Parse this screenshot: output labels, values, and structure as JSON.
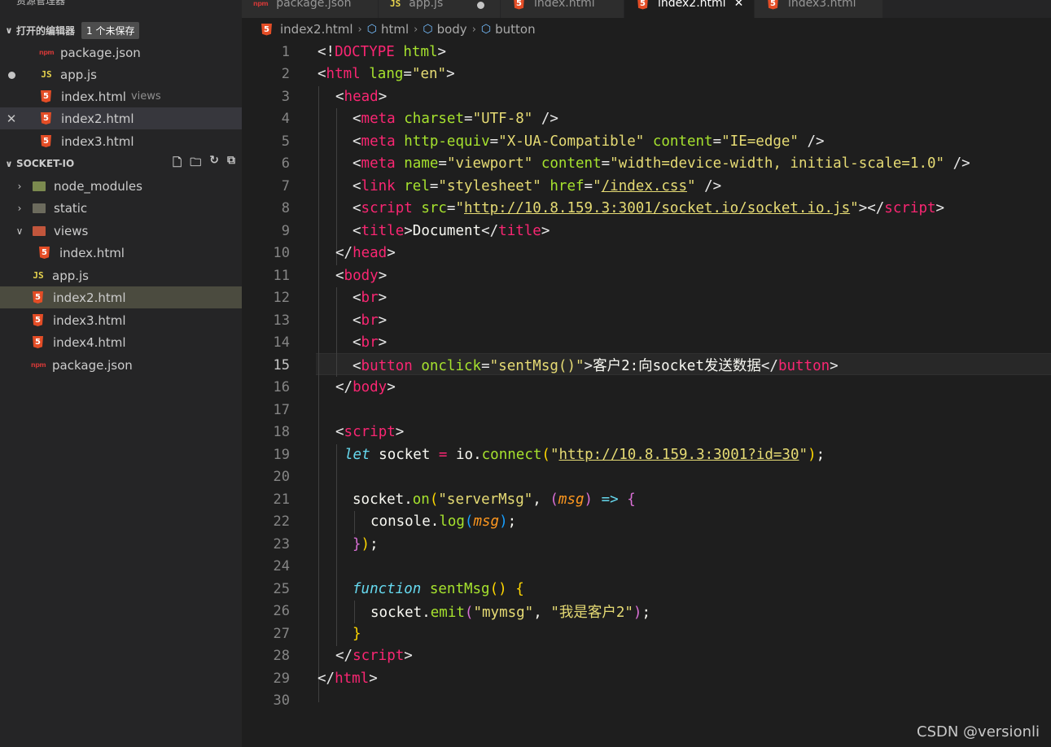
{
  "sidebar": {
    "title": "资源管理器",
    "more": "···",
    "open_editors": {
      "header": "打开的编辑器",
      "badge": "1 个未保存",
      "items": [
        {
          "name": "package.json",
          "icon": "npm-icon",
          "status": ""
        },
        {
          "name": "app.js",
          "icon": "js-icon",
          "status": "modified"
        },
        {
          "name": "index.html",
          "icon": "html5-icon",
          "hint": "views",
          "status": ""
        },
        {
          "name": "index2.html",
          "icon": "html5-icon",
          "status": "close"
        },
        {
          "name": "index3.html",
          "icon": "html5-icon",
          "status": ""
        }
      ]
    },
    "project": {
      "header": "SOCKET-IO",
      "tree": [
        {
          "name": "node_modules",
          "type": "folder",
          "expanded": false
        },
        {
          "name": "static",
          "type": "folder",
          "expanded": false
        },
        {
          "name": "views",
          "type": "folder",
          "expanded": true
        },
        {
          "name": "index.html",
          "type": "html",
          "indent": 1
        },
        {
          "name": "app.js",
          "type": "js"
        },
        {
          "name": "index2.html",
          "type": "html",
          "active": true
        },
        {
          "name": "index3.html",
          "type": "html"
        },
        {
          "name": "index4.html",
          "type": "html"
        },
        {
          "name": "package.json",
          "type": "json"
        }
      ]
    }
  },
  "tabs": [
    {
      "label": "package.json",
      "icon": "npm-icon"
    },
    {
      "label": "app.js",
      "icon": "js-icon",
      "modified": true
    },
    {
      "label": "index.html",
      "icon": "html5-icon"
    },
    {
      "label": "index2.html",
      "icon": "html5-icon",
      "active": true
    },
    {
      "label": "index3.html",
      "icon": "html5-icon"
    }
  ],
  "breadcrumb": [
    "index2.html",
    "html",
    "body",
    "button"
  ],
  "editor": {
    "current_line": 15,
    "line_numbers": [
      "1",
      "2",
      "3",
      "4",
      "5",
      "6",
      "7",
      "8",
      "9",
      "10",
      "11",
      "12",
      "13",
      "14",
      "15",
      "16",
      "17",
      "18",
      "19",
      "20",
      "21",
      "22",
      "23",
      "24",
      "25",
      "26",
      "27",
      "28",
      "29",
      "30"
    ]
  },
  "code": {
    "doctype": "DOCTYPE",
    "html": "html",
    "lang": "lang",
    "en": "\"en\"",
    "head": "head",
    "meta": "meta",
    "charset": "charset",
    "utf8": "\"UTF-8\"",
    "http_equiv": "http-equiv",
    "xua": "\"X-UA-Compatible\"",
    "content": "content",
    "ie_edge": "\"IE=edge\"",
    "name": "name",
    "viewport": "\"viewport\"",
    "viewport_content": "\"width=device-width, initial-scale=1.0\"",
    "link": "link",
    "rel": "rel",
    "stylesheet": "\"stylesheet\"",
    "href": "href",
    "href_val": "/index.css",
    "script": "script",
    "src": "src",
    "src_val": "http://10.8.159.3:3001/socket.io/socket.io.js",
    "title": "title",
    "title_text": "Document",
    "body": "body",
    "br": "br",
    "button": "button",
    "onclick": "onclick",
    "onclick_val": "\"sentMsg()\"",
    "button_text": "客户2:向socket发送数据",
    "let": "let",
    "socket_var": "socket",
    "io": "io",
    "connect": "connect",
    "connect_url": "http://10.8.159.3:3001?id=30",
    "on": "on",
    "server_msg": "\"serverMsg\"",
    "msg": "msg",
    "console": "console",
    "log": "log",
    "function": "function",
    "sent_msg": "sentMsg",
    "emit": "emit",
    "mymsg": "\"mymsg\"",
    "emit_text": "\"我是客户2\""
  },
  "watermark": "CSDN @versionli",
  "colors": {
    "tag": "#f92672",
    "attr": "#a6e22e",
    "string": "#e6db74",
    "keyword": "#66d9ef",
    "param": "#fd971f"
  }
}
